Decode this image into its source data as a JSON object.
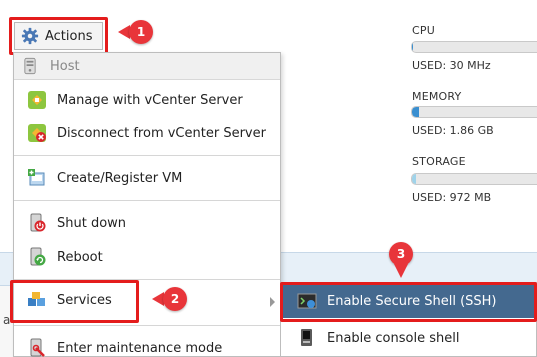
{
  "toolbar": {
    "actions_label": "Actions"
  },
  "menu": {
    "header": "Host",
    "items": [
      {
        "label": "Manage with vCenter Server",
        "icon": "vcenter-manage-icon"
      },
      {
        "label": "Disconnect from vCenter Server",
        "icon": "vcenter-disconnect-icon"
      },
      {
        "label": "Create/Register VM",
        "icon": "create-vm-icon"
      },
      {
        "label": "Shut down",
        "icon": "shutdown-icon"
      },
      {
        "label": "Reboot",
        "icon": "reboot-icon"
      },
      {
        "label": "Services",
        "icon": "services-icon"
      },
      {
        "label": "Enter maintenance mode",
        "icon": "maintenance-icon"
      }
    ]
  },
  "submenu": {
    "items": [
      {
        "label": "Enable Secure Shell (SSH)",
        "icon": "ssh-icon",
        "active": true
      },
      {
        "label": "Enable console shell",
        "icon": "console-shell-icon",
        "active": false
      }
    ]
  },
  "stats": {
    "cpu": {
      "label": "CPU",
      "used": "USED: 30 MHz",
      "fraction": 0.01
    },
    "memory": {
      "label": "MEMORY",
      "used": "USED: 1.86 GB",
      "fraction": 0.05
    },
    "storage": {
      "label": "STORAGE",
      "used": "USED: 972 MB",
      "fraction": 0.03
    }
  },
  "badges": [
    "1",
    "2",
    "3"
  ],
  "background": {
    "stub_text": "a"
  },
  "colors": {
    "highlight_box": "#e41c1c",
    "badge": "#e8353a",
    "active_item": "#44698f",
    "memory_fill": "#3a8fd0",
    "storage_fill": "#9fd3ea"
  }
}
